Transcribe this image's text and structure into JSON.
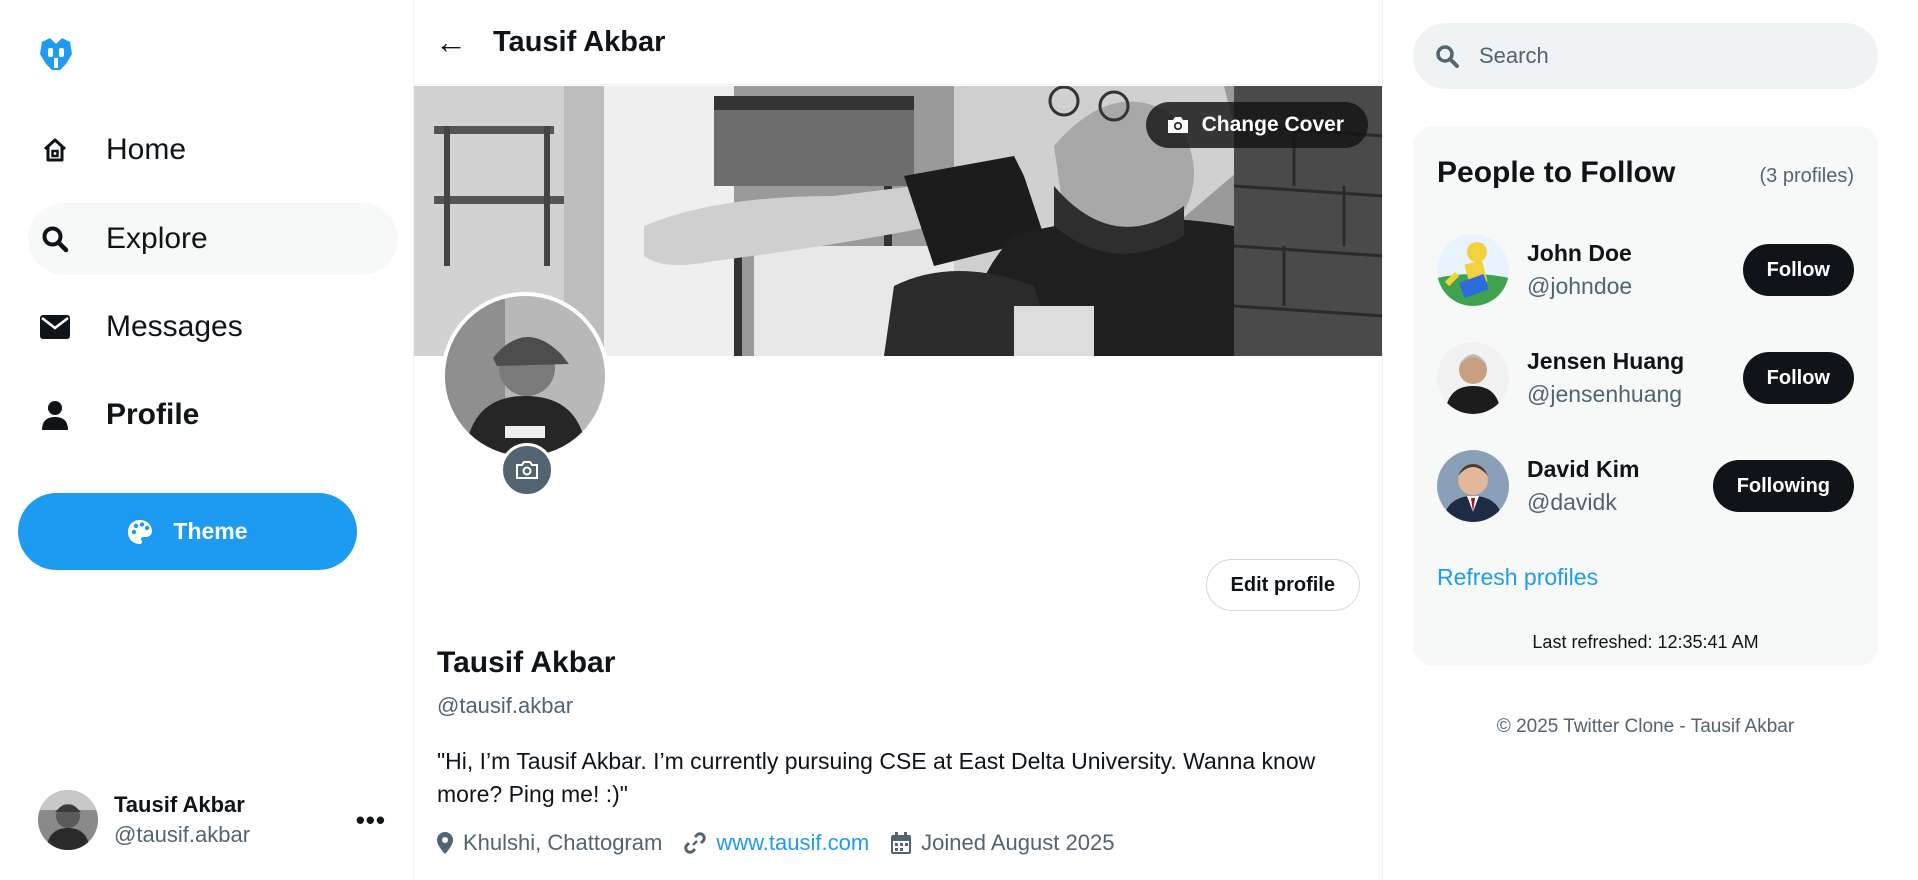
{
  "sidebar": {
    "logo_icon": "robot-bird-logo",
    "items": [
      {
        "label": "Home",
        "icon": "home-icon"
      },
      {
        "label": "Explore",
        "icon": "search-icon"
      },
      {
        "label": "Messages",
        "icon": "envelope-icon"
      },
      {
        "label": "Profile",
        "icon": "user-icon"
      }
    ],
    "theme_label": "Theme",
    "user": {
      "name": "Tausif Akbar",
      "handle": "@tausif.akbar",
      "more": "•••"
    }
  },
  "header": {
    "back": "←",
    "title": "Tausif Akbar"
  },
  "profile": {
    "change_cover_label": "Change Cover",
    "edit_label": "Edit profile",
    "name": "Tausif Akbar",
    "handle": "@tausif.akbar",
    "bio": "\"Hi, I’m Tausif Akbar. I’m currently pursuing CSE at East Delta University. Wanna know more? Ping me! :)\"",
    "location": "Khulshi, Chattogram",
    "website": "www.tausif.com",
    "joined": "Joined August 2025"
  },
  "search": {
    "placeholder": "Search"
  },
  "people": {
    "title": "People to Follow",
    "count": "(3 profiles)",
    "list": [
      {
        "name": "John Doe",
        "handle": "@johndoe",
        "button": "Follow"
      },
      {
        "name": "Jensen Huang",
        "handle": "@jensenhuang",
        "button": "Follow"
      },
      {
        "name": "David Kim",
        "handle": "@davidk",
        "button": "Following"
      }
    ],
    "refresh_label": "Refresh profiles",
    "last_refreshed": "Last refreshed: 12:35:41 AM"
  },
  "footer": "© 2025 Twitter Clone - Tausif Akbar",
  "colors": {
    "accent": "#1d9bf0",
    "text": "#0f1419",
    "muted": "#536471",
    "button_dark": "#0f1419"
  }
}
